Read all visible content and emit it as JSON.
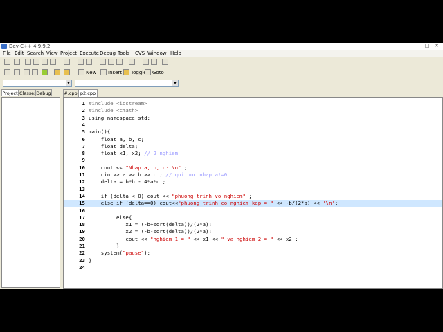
{
  "window": {
    "title": "Dev-C++ 4.9.9.2"
  },
  "menu": [
    "File",
    "Edit",
    "Search",
    "View",
    "Project",
    "Execute",
    "Debug",
    "Tools",
    "CVS",
    "Window",
    "Help"
  ],
  "toolbar": {
    "new_label": "New",
    "insert_label": "Insert",
    "toggle_label": "Toggle",
    "goto_label": "Goto"
  },
  "side_tabs": [
    "Project",
    "Classes",
    "Debug"
  ],
  "editor_tabs": [
    "#.cpp",
    "p2.cpp"
  ],
  "code_lines": [
    {
      "n": "1",
      "segs": [
        {
          "t": "#include <iostream>",
          "c": "pp"
        }
      ]
    },
    {
      "n": "2",
      "segs": [
        {
          "t": "#include <cmath>",
          "c": "pp"
        }
      ]
    },
    {
      "n": "3",
      "segs": [
        {
          "t": "using namespace std;",
          "c": ""
        }
      ]
    },
    {
      "n": "4",
      "segs": []
    },
    {
      "n": "5",
      "segs": [
        {
          "t": "main(){",
          "c": ""
        }
      ]
    },
    {
      "n": "6",
      "segs": [
        {
          "t": "    float a, b, c;",
          "c": ""
        }
      ]
    },
    {
      "n": "7",
      "segs": [
        {
          "t": "    float delta;",
          "c": ""
        }
      ]
    },
    {
      "n": "8",
      "segs": [
        {
          "t": "    float x1, x2; ",
          "c": ""
        },
        {
          "t": "// 2 nghiem",
          "c": "cmt"
        }
      ]
    },
    {
      "n": "9",
      "segs": []
    },
    {
      "n": "10",
      "segs": [
        {
          "t": "    cout << ",
          "c": ""
        },
        {
          "t": "\"Nhap a, b, c: \\n\"",
          "c": "str"
        },
        {
          "t": " ;",
          "c": ""
        }
      ]
    },
    {
      "n": "11",
      "segs": [
        {
          "t": "    cin >> a >> b >> c ; ",
          "c": ""
        },
        {
          "t": "// qui uoc nhap a!=0",
          "c": "cmt"
        }
      ]
    },
    {
      "n": "12",
      "segs": [
        {
          "t": "    delta = b*b - 4*a*c ;",
          "c": ""
        }
      ]
    },
    {
      "n": "13",
      "segs": []
    },
    {
      "n": "14",
      "segs": [
        {
          "t": "    if (delta < 0) cout << ",
          "c": ""
        },
        {
          "t": "\"phuong trinh vo nghiem\"",
          "c": "str"
        },
        {
          "t": " ;",
          "c": ""
        }
      ]
    },
    {
      "n": "15",
      "hl": true,
      "segs": [
        {
          "t": "    else if (delta==0) cout<<",
          "c": ""
        },
        {
          "t": "\"phuong trinh co nghiem kep = \"",
          "c": "str"
        },
        {
          "t": " << -b/(2*a) << ",
          "c": ""
        },
        {
          "t": "'\\n'",
          "c": "str"
        },
        {
          "t": ";",
          "c": ""
        }
      ]
    },
    {
      "n": "16",
      "segs": []
    },
    {
      "n": "17",
      "segs": [
        {
          "t": "         else{",
          "c": ""
        }
      ]
    },
    {
      "n": "18",
      "segs": [
        {
          "t": "            x1 = (-b+sqrt(delta))/(2*a);",
          "c": ""
        }
      ]
    },
    {
      "n": "19",
      "segs": [
        {
          "t": "            x2 = (-b-sqrt(delta))/(2*a);",
          "c": ""
        }
      ]
    },
    {
      "n": "20",
      "segs": [
        {
          "t": "            cout << ",
          "c": ""
        },
        {
          "t": "\"nghiem 1 = \"",
          "c": "str"
        },
        {
          "t": " << x1 << ",
          "c": ""
        },
        {
          "t": "\" va nghiem 2 = \"",
          "c": "str"
        },
        {
          "t": " << x2 ;",
          "c": ""
        }
      ]
    },
    {
      "n": "21",
      "segs": [
        {
          "t": "         }",
          "c": ""
        }
      ]
    },
    {
      "n": "22",
      "segs": [
        {
          "t": "    system(",
          "c": ""
        },
        {
          "t": "\"pause\"",
          "c": "str"
        },
        {
          "t": ");",
          "c": ""
        }
      ]
    },
    {
      "n": "23",
      "segs": [
        {
          "t": "}",
          "c": ""
        }
      ]
    },
    {
      "n": "24",
      "segs": []
    }
  ]
}
